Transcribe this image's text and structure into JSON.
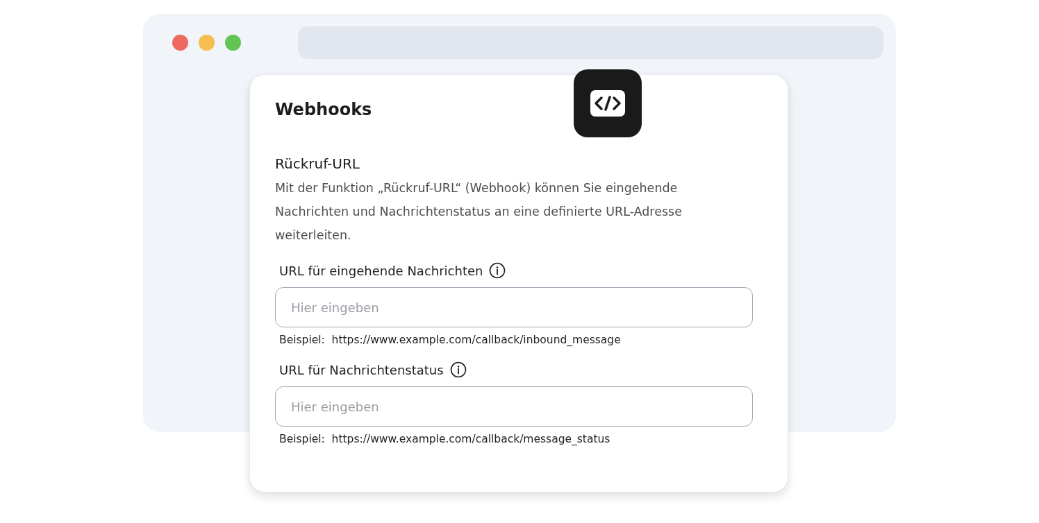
{
  "browser": {
    "traffic_lights": [
      {
        "color": "#ee6a5f"
      },
      {
        "color": "#f5be4f"
      },
      {
        "color": "#61c454"
      }
    ]
  },
  "card": {
    "title": "Webhooks",
    "section_title": "Rückruf-URL",
    "description": "Mit der Funktion „Rückruf-URL“ (Webhook) können Sie eingehende Nachrichten und Nachrichtenstatus an eine definierte URL-Adresse weiterleiten.",
    "fields": [
      {
        "label": "URL für eingehende Nachrichten",
        "placeholder": "Hier eingeben",
        "example": "Beispiel:  https://www.example.com/callback/inbound_message"
      },
      {
        "label": "URL für Nachrichtenstatus",
        "placeholder": "Hier eingeben",
        "example": "Beispiel:  https://www.example.com/callback/message_status"
      }
    ]
  }
}
